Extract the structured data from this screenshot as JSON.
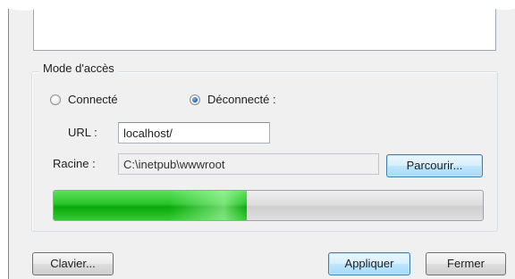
{
  "access_mode": {
    "group_label": "Mode d'accès",
    "options": [
      {
        "label": "Connecté",
        "checked": false
      },
      {
        "label": "Déconnecté :",
        "checked": true
      }
    ]
  },
  "url": {
    "label": "URL :",
    "value": "localhost/"
  },
  "root": {
    "label": "Racine :",
    "value": "C:\\inetpub\\wwwroot",
    "browse_label": "Parcourir..."
  },
  "progress": {
    "fraction": 0.45,
    "fill_color": "#1fbf1f"
  },
  "footer": {
    "keyboard_label": "Clavier...",
    "apply_label": "Appliquer",
    "close_label": "Fermer"
  }
}
